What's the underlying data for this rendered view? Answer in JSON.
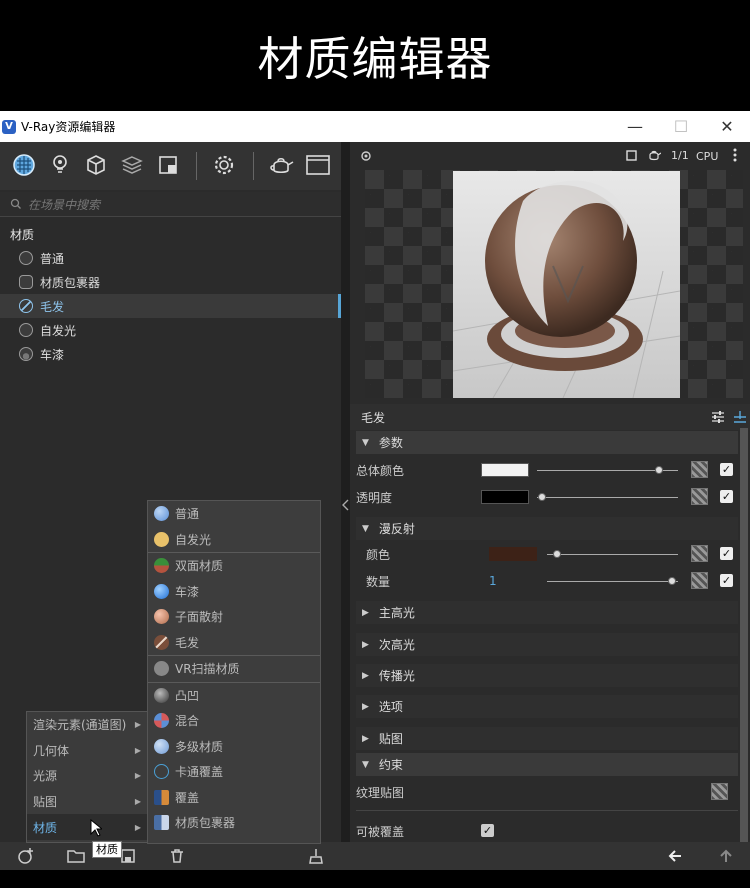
{
  "banner": {
    "title": "材质编辑器"
  },
  "window": {
    "app_title": "V-Ray资源编辑器",
    "logo_letter": "V",
    "minimize": "—",
    "maximize": "☐",
    "close": "✕"
  },
  "search": {
    "placeholder": "在场景中搜索"
  },
  "categories": {
    "materials_label": "材质"
  },
  "materials": [
    {
      "label": "普通"
    },
    {
      "label": "材质包裹器"
    },
    {
      "label": "毛发",
      "selected": true
    },
    {
      "label": "自发光"
    },
    {
      "label": "车漆"
    }
  ],
  "context_menu": {
    "items": [
      {
        "label": "渲染元素(通道图)"
      },
      {
        "label": "几何体"
      },
      {
        "label": "光源"
      },
      {
        "label": "贴图"
      },
      {
        "label": "材质",
        "active": true
      }
    ]
  },
  "submenu": {
    "items": [
      {
        "label": "普通",
        "color": "#5b8fd6"
      },
      {
        "label": "自发光",
        "color": "#e8c16a"
      },
      {
        "label": "双面材质",
        "color": "#b5533e"
      },
      {
        "label": "车漆",
        "color": "#1f6fd6"
      },
      {
        "label": "子面散射",
        "color": "#d98a6a"
      },
      {
        "label": "毛发",
        "color": "#7a4e3a"
      },
      {
        "label": "VR扫描材质",
        "color": "#888888"
      },
      {
        "label": "凸凹",
        "color": "#444444"
      },
      {
        "label": "混合",
        "color": "#d65a5a"
      },
      {
        "label": "多级材质",
        "color": "#6f9bd6"
      },
      {
        "label": "卡通覆盖",
        "color": "#4aa0d6"
      },
      {
        "label": "覆盖",
        "color": "#d68a3a"
      },
      {
        "label": "材质包裹器",
        "color": "#4a6fa5"
      }
    ]
  },
  "tooltip": {
    "text": "材质"
  },
  "preview": {
    "cpu_label": "CPU",
    "ratio": "1/1"
  },
  "panel": {
    "title": "毛发",
    "sections": {
      "params": "参数",
      "diffuse": "漫反射",
      "primary_spec": "主高光",
      "secondary_spec": "次高光",
      "transmission": "传播光",
      "options": "选项",
      "maps": "贴图",
      "constraint": "约束"
    },
    "rows": {
      "overall_color": "总体颜色",
      "transparency": "透明度",
      "color": "颜色",
      "amount": "数量",
      "amount_value": "1",
      "texture_map": "纹理贴图",
      "overridable": "可被覆盖"
    },
    "sliders": {
      "overall_color": 0.95,
      "transparency": 0.02,
      "diffuse_color": 0.08,
      "amount": 0.98
    },
    "colors": {
      "overall_color": "#f2f2f2",
      "transparency": "#000000",
      "diffuse_color": "#3d2217"
    }
  },
  "colors": {
    "accent": "#57a5d6",
    "selected_text": "#8ec4ec"
  }
}
